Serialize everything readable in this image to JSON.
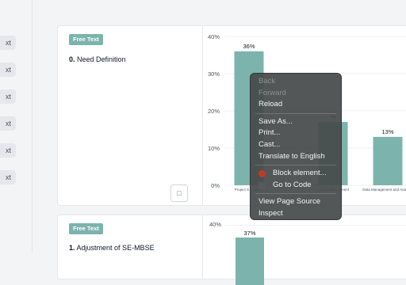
{
  "sidebar": {
    "chips": [
      "xt",
      "xt",
      "xt",
      "xt",
      "xt",
      "xt"
    ]
  },
  "card1": {
    "badge": "Free Text",
    "question_number": "0.",
    "question_text": "Need Definition",
    "expand_icon": "chart-expand-icon"
  },
  "card2": {
    "badge": "Free Text",
    "question_number": "1.",
    "question_text": "Adjustment of SE-MBSE",
    "top_tick": "40%",
    "bar_label": "37%"
  },
  "chart_data": {
    "type": "bar",
    "ylim": [
      0,
      40
    ],
    "yticks": [
      "40%",
      "30%",
      "20%",
      "10%",
      "0%"
    ],
    "categories": [
      "Project S... Obje...",
      "...ation and ...ement",
      "Data Management and Analysis"
    ],
    "values": [
      36,
      17,
      13
    ],
    "value_labels": [
      "36%",
      "%",
      "13%"
    ],
    "bar_color": "#7cb3ad"
  },
  "context_menu": {
    "items": [
      {
        "label": "Back",
        "enabled": false
      },
      {
        "label": "Forward",
        "enabled": false
      },
      {
        "label": "Reload",
        "enabled": true
      },
      {
        "label": "Save As...",
        "enabled": true
      },
      {
        "label": "Print...",
        "enabled": true
      },
      {
        "label": "Cast...",
        "enabled": true
      },
      {
        "label": "Translate to English",
        "enabled": true
      },
      {
        "label": "Block element...",
        "enabled": true,
        "icon": "ublock-icon"
      },
      {
        "label": "Go to Code",
        "enabled": true,
        "icon": "code-extension-icon"
      },
      {
        "label": "View Page Source",
        "enabled": true
      },
      {
        "label": "Inspect",
        "enabled": true
      }
    ]
  }
}
